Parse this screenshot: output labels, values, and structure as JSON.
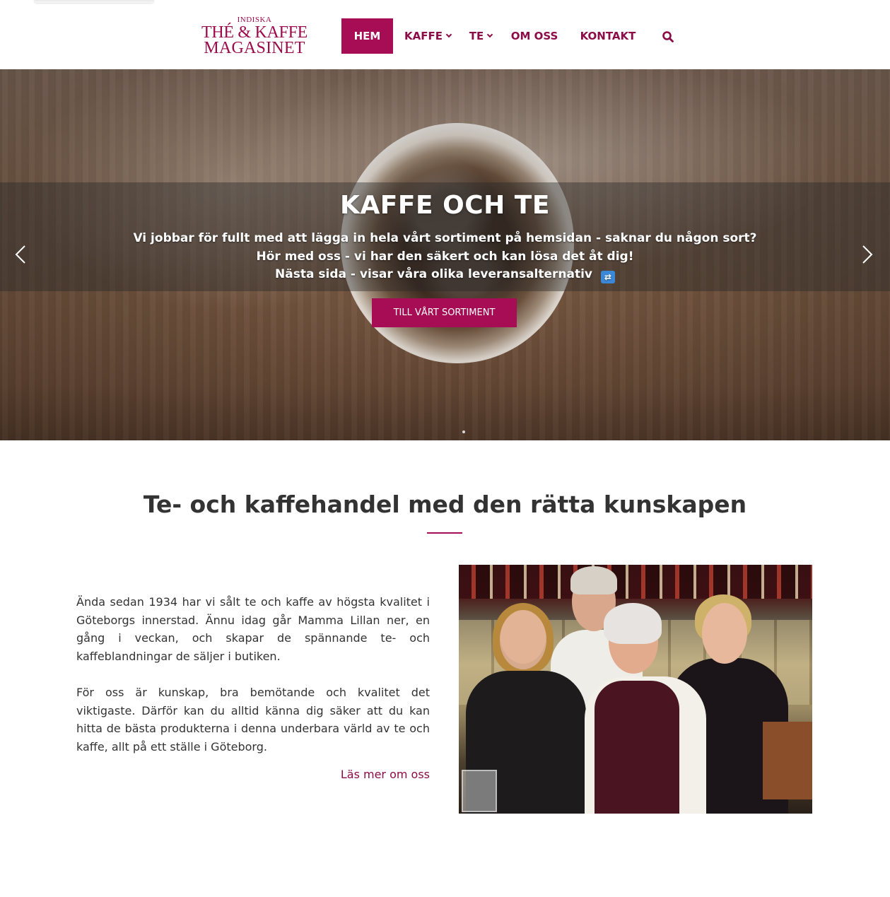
{
  "header": {
    "logo": {
      "line1": "INDISKA",
      "line2": "THÉ & KAFFE",
      "line3": "MAGASINET"
    },
    "nav": [
      {
        "label": "HEM",
        "active": true
      },
      {
        "label": "KAFFE",
        "dropdown": true
      },
      {
        "label": "TE",
        "dropdown": true
      },
      {
        "label": "OM OSS"
      },
      {
        "label": "KONTAKT"
      }
    ],
    "search_icon": "search-icon"
  },
  "hero": {
    "title": "KAFFE OCH TE",
    "line1": "Vi jobbar för fullt med att lägga in hela vårt sortiment på hemsidan - saknar du någon sort?",
    "line2": "Hör med oss - vi har den säkert och kan lösa det åt dig!",
    "line3": "Nästa sida - visar våra olika leveransalternativ",
    "line3_emoji": "⇄",
    "cta_label": "TILL VÅRT SORTIMENT",
    "prev_icon": "chevron-left-icon",
    "next_icon": "chevron-right-icon"
  },
  "main": {
    "title": "Te- och kaffehandel med den rätta kunskapen",
    "paragraph1": "Ända sedan 1934 har vi sålt te och kaffe av högsta kvalitet i Göteborgs innerstad. Ännu idag går Mamma Lillan ner, en gång i veckan, och skapar de spännande te- och kaffeblandningar de säljer i butiken.",
    "paragraph2": "För oss är kunskap, bra bemötande och kvalitet det viktigaste. Därför kan du alltid känna dig säker att du kan hitta de bästa produkterna i denna underbara värld av te och kaffe, allt på ett ställe i Göteborg.",
    "read_more": "Läs mer om oss"
  },
  "colors": {
    "brand": "#a70d55",
    "brand_text": "#8c0c47",
    "body_text": "#333333"
  }
}
